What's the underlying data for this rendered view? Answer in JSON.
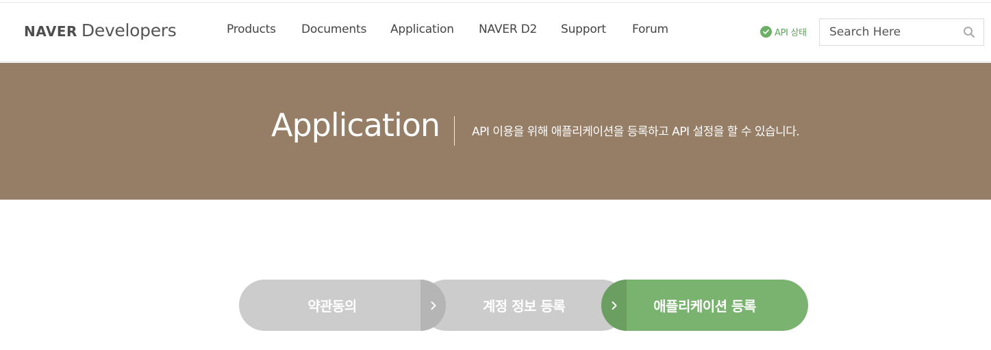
{
  "header": {
    "logo": {
      "brand": "NAVER",
      "product": "Developers"
    },
    "nav": [
      "Products",
      "Documents",
      "Application",
      "NAVER D2",
      "Support",
      "Forum"
    ],
    "api_status": {
      "label": "API 상태",
      "icon": "check-circle-icon",
      "color": "#6aaf65"
    },
    "search": {
      "placeholder": "Search Here",
      "icon": "search-icon"
    }
  },
  "banner": {
    "title": "Application",
    "description": "API 이용을 위해 애플리케이션을 등록하고 API 설정을 할 수 있습니다.",
    "background": "#957d66"
  },
  "steps": {
    "items": [
      {
        "label": "약관동의",
        "state": "inactive"
      },
      {
        "label": "계정 정보 등록",
        "state": "inactive"
      },
      {
        "label": "애플리케이션 등록",
        "state": "active"
      }
    ],
    "separator_icon": "chevron-right-icon",
    "active_color": "#7ab270",
    "inactive_color": "#cccccc"
  }
}
